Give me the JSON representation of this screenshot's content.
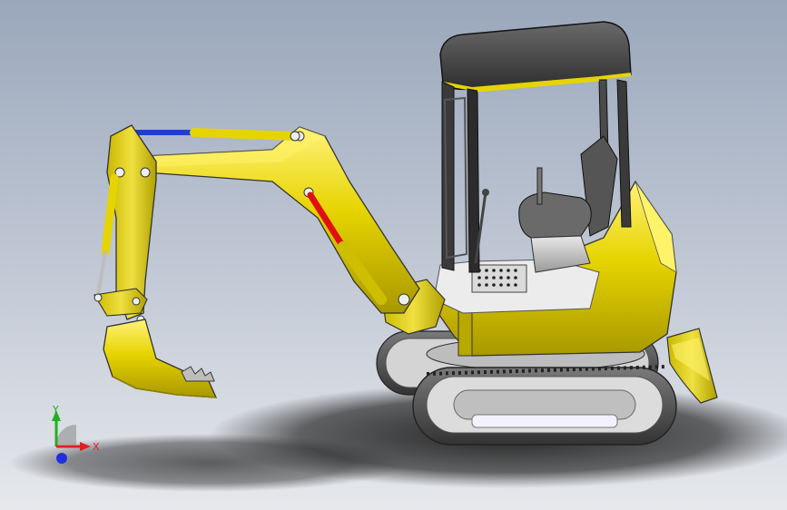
{
  "viewport": {
    "background_top": "#9aa7bb",
    "background_bottom": "#e6e8ec"
  },
  "model": {
    "body_color": "#e6d400",
    "cab_frame_color": "#3a3a3a",
    "track_color": "#4a4a4a",
    "cylinder_blue": "#1f3fd0",
    "cylinder_red": "#e01010"
  },
  "triad": {
    "x_label": "X",
    "y_label": "Y",
    "x_color": "#e02020",
    "y_color": "#20b020",
    "z_color": "#2030e0"
  }
}
